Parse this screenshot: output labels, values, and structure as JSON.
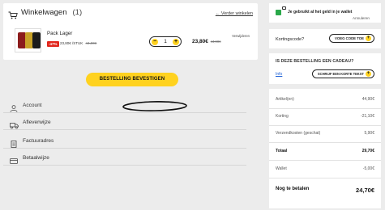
{
  "cart": {
    "title": "Winkelwagen",
    "count": "(1)",
    "continue_link": "← Verder winkelen",
    "item": {
      "name": "Pack Lager",
      "discount": "-47%",
      "unit_price": "23,80€ /STUK",
      "unit_price_old": "44,90€",
      "quantity": "1",
      "total": "23,80€",
      "total_old": "44,90€",
      "delete_label": "Verwijderen"
    }
  },
  "confirm_button": "BESTELLING BEVESTIGEN",
  "accordion": [
    {
      "label": "Account",
      "icon": "user-icon"
    },
    {
      "label": "Afleverwijze",
      "icon": "truck-icon"
    },
    {
      "label": "Factuuradres",
      "icon": "document-icon"
    },
    {
      "label": "Betaalwijze",
      "icon": "credit-card-icon"
    }
  ],
  "wallet": {
    "text": "Je gebruikt al het geld in je wallet",
    "cancel": "Annuleren"
  },
  "voucher": {
    "label": "Kortingscode?",
    "button": "VOEG CODE TOE"
  },
  "gift": {
    "title": "IS DEZE BESTELLING EEN CADEAU?",
    "info_link": "Info",
    "button": "SCHRIJF EEN KORTE TEKST"
  },
  "summary": {
    "articles_label": "Artikel(en)",
    "articles_value": "44,90€",
    "discount_label": "Korting",
    "discount_value": "-21,10€",
    "shipping_label": "Verzendkosten (geschat)",
    "shipping_value": "5,90€",
    "total_label": "Totaal",
    "total_value": "29,70€",
    "wallet_label": "Wallet",
    "wallet_value": "-5,00€",
    "pay_label": "Nog te betalen",
    "pay_value": "24,70€"
  },
  "colors": {
    "accent_yellow": "#ffd21f",
    "discount_red": "#e1251b",
    "wallet_green": "#2aa84a",
    "link_blue": "#1a5ed6"
  }
}
